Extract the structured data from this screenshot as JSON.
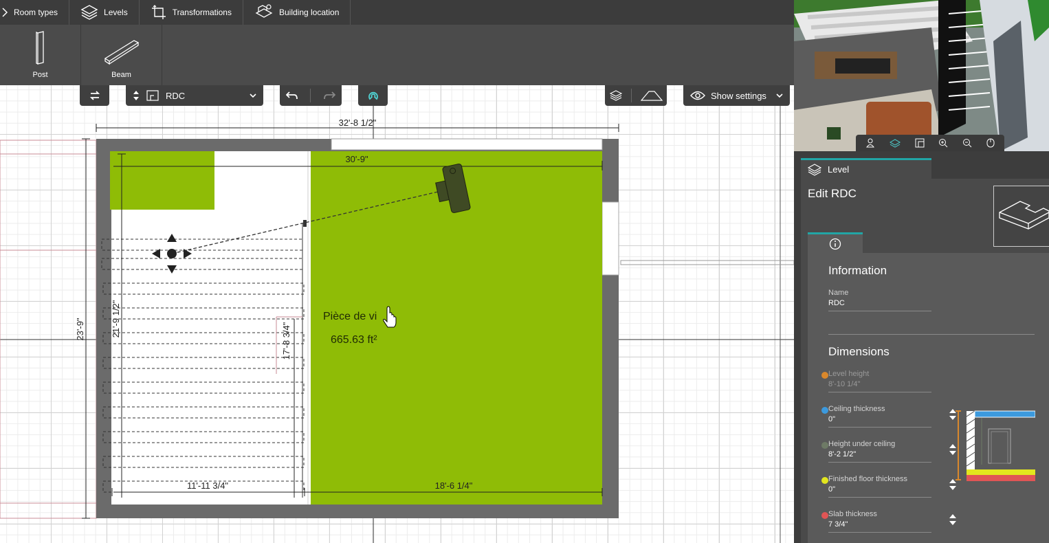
{
  "tabs": [
    {
      "label": "Room types",
      "icon": "chevron-right-icon"
    },
    {
      "label": "Levels",
      "icon": "levels-icon"
    },
    {
      "label": "Transformations",
      "icon": "transform-icon"
    },
    {
      "label": "Building location",
      "icon": "building-location-icon"
    }
  ],
  "tools": [
    {
      "label": "Post",
      "icon": "post-icon"
    },
    {
      "label": "Beam",
      "icon": "beam-icon"
    }
  ],
  "canvas_toolbar": {
    "level_select": "RDC",
    "show_settings": "Show settings"
  },
  "plan": {
    "dim_top": "32'-8 1/2\"",
    "dim_inner_top": "30'-9\"",
    "dim_left": "23'-9\"",
    "dim_left_inner": "21'-9 1/2\"",
    "dim_stair": "17'-8 3/4\"",
    "dim_bottom_left": "11'-11 3/4\"",
    "dim_bottom_right": "18'-6 1/4\"",
    "room_name": "Pièce de vi",
    "room_area": "665.63 ft²"
  },
  "panel": {
    "tab_label": "Level",
    "edit_title": "Edit RDC",
    "information_title": "Information",
    "name_label": "Name",
    "name_value": "RDC",
    "dimensions_title": "Dimensions",
    "dimensions": [
      {
        "label": "Level height",
        "value": "8'-10 1/4\"",
        "color": "#d9882c",
        "disabled": true
      },
      {
        "label": "Ceiling thickness",
        "value": "0\"",
        "color": "#3c9ade",
        "disabled": false
      },
      {
        "label": "Height under ceiling",
        "value": "8'-2 1/2\"",
        "color": "#6e7a66",
        "disabled": false
      },
      {
        "label": "Finished floor thickness",
        "value": "0\"",
        "color": "#e2e61e",
        "disabled": false
      },
      {
        "label": "Slab thickness",
        "value": "7 3/4\"",
        "color": "#e05555",
        "disabled": false
      }
    ]
  },
  "colors": {
    "room_fill": "#8fbc06",
    "wall": "#6b6b6b",
    "accent": "#21a6a6"
  }
}
